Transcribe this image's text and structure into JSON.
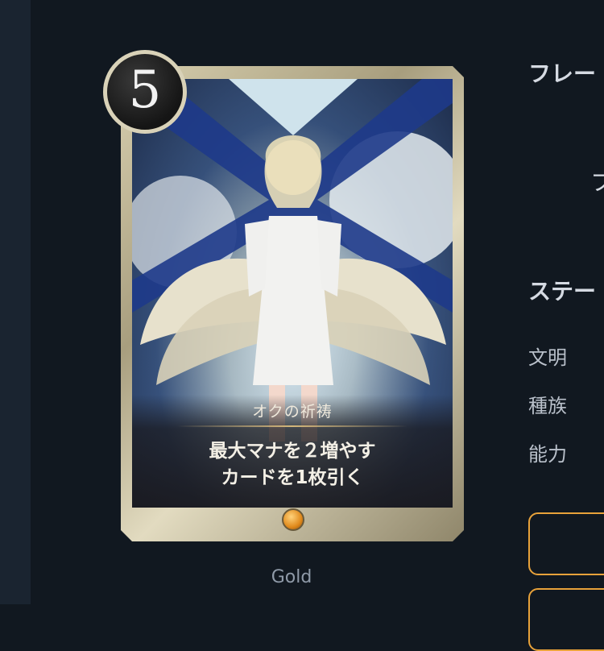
{
  "card": {
    "cost": "5",
    "name": "オクの祈祷",
    "effect_line1": "最大マナを２増やす",
    "effect_line2": "カードを1枚引く",
    "rarity": "Gold"
  },
  "panel": {
    "frame_heading": "フレー",
    "frame_value": "フ",
    "status_heading": "ステー",
    "attributes": [
      {
        "label": "文明"
      },
      {
        "label": "種族"
      },
      {
        "label": "能力"
      }
    ]
  },
  "colors": {
    "background": "#111820",
    "accent_border": "#e8a23a",
    "frame_gold": "#d8d0b0"
  }
}
